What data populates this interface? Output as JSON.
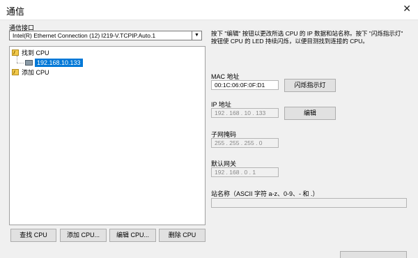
{
  "window": {
    "title": "通信",
    "close_glyph": "✕"
  },
  "interface": {
    "label": "通信接口",
    "selected": "Intel(R) Ethernet Connection (12) I219-V.TCPIP.Auto.1",
    "arrow": "▼"
  },
  "tree": {
    "found_cpu": "找到 CPU",
    "device_ip": "192.168.10.133",
    "add_cpu": "添加 CPU"
  },
  "buttons": {
    "find": "查找 CPU",
    "add": "添加 CPU...",
    "edit": "编辑 CPU...",
    "delete": "删除 CPU",
    "flash": "闪烁指示灯",
    "edit_ip": "编辑"
  },
  "description": "按下 \"编辑\" 按钮以更改所选 CPU 的 IP 数据和站名称。按下 \"闪烁指示灯\" 按钮使 CPU 的 LED 持续闪烁，以便目测找到连接的 CPU。",
  "mac": {
    "label": "MAC 地址",
    "value": "00:1C:06:0F:0F:D1"
  },
  "ip": {
    "label": "IP 地址",
    "value": "192 . 168 . 10 . 133"
  },
  "subnet": {
    "label": "子网掩码",
    "value": "255 . 255 . 255 . 0"
  },
  "gateway": {
    "label": "默认网关",
    "value": "192 . 168 . 0 . 1"
  },
  "station": {
    "label": "站名称（ASCII 字符 a-z、0-9、- 和 .）",
    "value": ""
  }
}
